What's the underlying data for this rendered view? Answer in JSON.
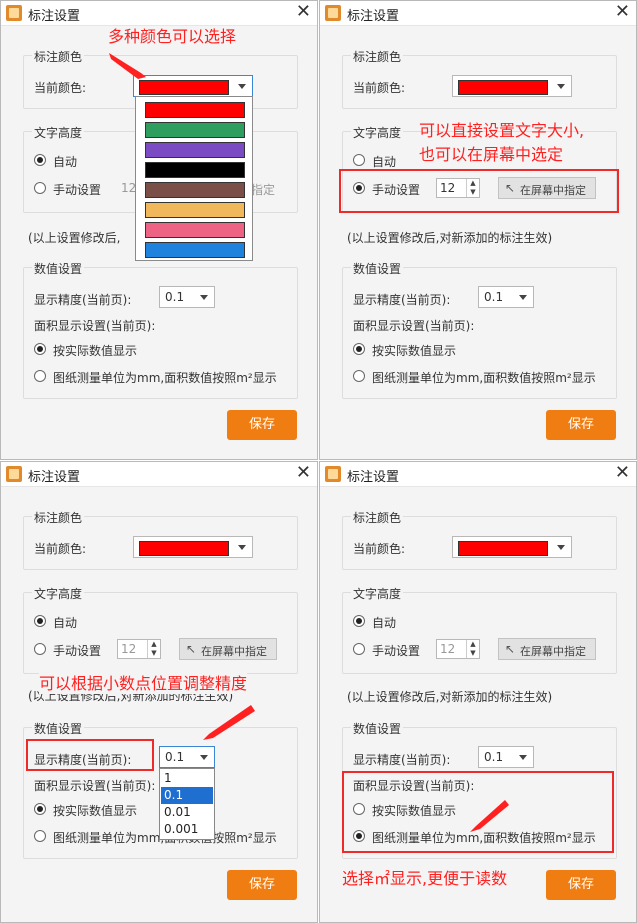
{
  "dialog": {
    "title": "标注设置",
    "color_group_title": "标注颜色",
    "current_color_label": "当前颜色:",
    "current_color": "#ff0000",
    "text_height_title": "文字高度",
    "auto_label": "自动",
    "manual_label": "手动设置",
    "font_size": "12",
    "pick_screen_label": "在屏幕中指定",
    "note": "(以上设置修改后,对新添加的标注生效)",
    "note_partial": "(以上设置修改后,",
    "value_group_title": "数值设置",
    "precision_label": "显示精度(当前页):",
    "precision_value": "0.1",
    "area_label": "面积显示设置(当前页):",
    "area_actual": "按实际数值显示",
    "area_mm": "图纸测量单位为mm,面积数值按照m²显示",
    "save_label": "保存"
  },
  "color_options": [
    {
      "color": "#ff0000"
    },
    {
      "color": "#2e9e5e"
    },
    {
      "color": "#7b4bc4"
    },
    {
      "color": "#000000"
    },
    {
      "color": "#7a4f48"
    },
    {
      "color": "#f0b85a"
    },
    {
      "color": "#ec6383"
    },
    {
      "color": "#1f82dc"
    }
  ],
  "precision_options": [
    "1",
    "0.1",
    "0.01",
    "0.001"
  ],
  "precision_selected_index": 1,
  "annotations": {
    "colors": "多种颜色可以选择",
    "text_size_line1": "可以直接设置文字大小,",
    "text_size_line2": "也可以在屏幕中选定",
    "precision": "可以根据小数点位置调整精度",
    "area": "选择㎡显示,更便于读数"
  }
}
